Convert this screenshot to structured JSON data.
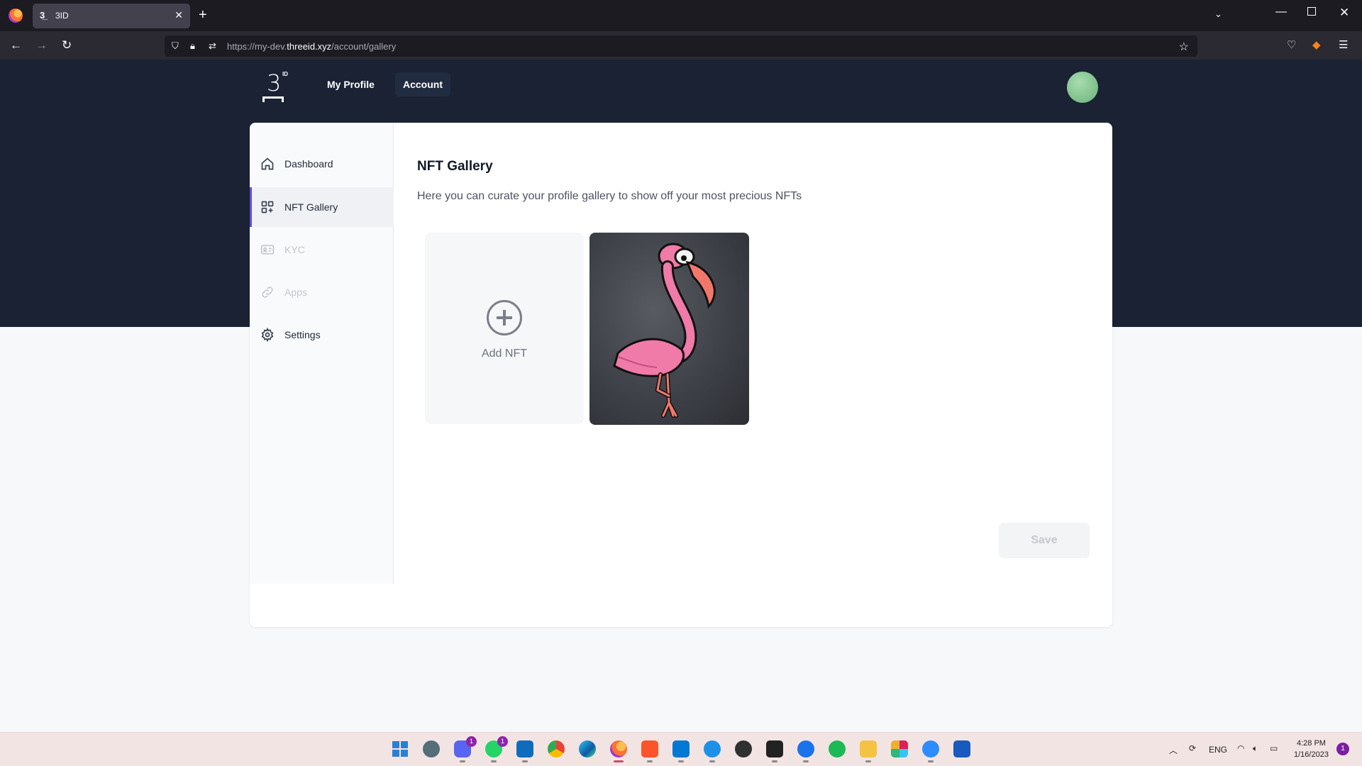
{
  "browser": {
    "tab_title": "3ID",
    "url_prefix": "https://my-dev.",
    "url_domain": "threeid.xyz",
    "url_path": "/account/gallery"
  },
  "header": {
    "logo_text": "3",
    "logo_sup": "ID",
    "nav": [
      {
        "label": "My Profile",
        "active": false
      },
      {
        "label": "Account",
        "active": true
      }
    ]
  },
  "sidebar": {
    "items": [
      {
        "label": "Dashboard",
        "icon": "home-icon",
        "state": "normal"
      },
      {
        "label": "NFT Gallery",
        "icon": "grid-plus-icon",
        "state": "active"
      },
      {
        "label": "KYC",
        "icon": "id-card-icon",
        "state": "disabled"
      },
      {
        "label": "Apps",
        "icon": "link-icon",
        "state": "disabled"
      },
      {
        "label": "Settings",
        "icon": "gear-icon",
        "state": "normal"
      }
    ]
  },
  "main": {
    "title": "NFT Gallery",
    "description": "Here you can curate your profile gallery to show off your most precious NFTs",
    "add_label": "Add NFT",
    "save_label": "Save"
  },
  "taskbar": {
    "language": "ENG",
    "time": "4:28 PM",
    "date": "1/16/2023",
    "notification_count": "1",
    "discord_badge": "1",
    "whatsapp_badge": "1"
  },
  "colors": {
    "hero_bg": "#1a2234",
    "active_accent": "#5b4fe0"
  }
}
